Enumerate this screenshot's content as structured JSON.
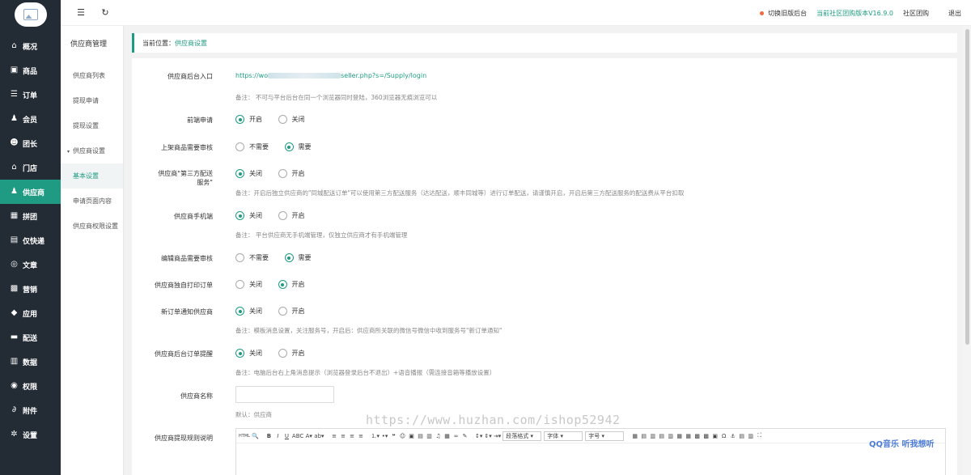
{
  "sidebar": {
    "items": [
      {
        "label": "概况",
        "icon": "home-icon",
        "glyph": "⌂"
      },
      {
        "label": "商品",
        "icon": "goods-icon",
        "glyph": "▣"
      },
      {
        "label": "订单",
        "icon": "order-icon",
        "glyph": "☰"
      },
      {
        "label": "会员",
        "icon": "member-icon",
        "glyph": "♟"
      },
      {
        "label": "团长",
        "icon": "leader-icon",
        "glyph": "☻"
      },
      {
        "label": "门店",
        "icon": "store-icon",
        "glyph": "⌂"
      },
      {
        "label": "供应商",
        "icon": "supplier-icon",
        "glyph": "♟"
      },
      {
        "label": "拼团",
        "icon": "group-buy-icon",
        "glyph": "▦"
      },
      {
        "label": "仅快递",
        "icon": "express-icon",
        "glyph": "▤"
      },
      {
        "label": "文章",
        "icon": "article-icon",
        "glyph": "◎"
      },
      {
        "label": "营销",
        "icon": "marketing-icon",
        "glyph": "▩"
      },
      {
        "label": "应用",
        "icon": "app-icon",
        "glyph": "◆"
      },
      {
        "label": "配送",
        "icon": "delivery-icon",
        "glyph": "▬"
      },
      {
        "label": "数据",
        "icon": "data-icon",
        "glyph": "▥"
      },
      {
        "label": "权限",
        "icon": "permission-icon",
        "glyph": "◉"
      },
      {
        "label": "附件",
        "icon": "attachment-icon",
        "glyph": "∂"
      },
      {
        "label": "设置",
        "icon": "settings-icon",
        "glyph": "✲"
      }
    ]
  },
  "subnav": {
    "title": "供应商管理",
    "items": [
      "供应商列表",
      "提现申请",
      "提现设置",
      "供应商设置",
      "基本设置",
      "申请页面内容",
      "供应商权限设置"
    ]
  },
  "topbar": {
    "collapse_icon": "☰",
    "refresh_icon": "↻",
    "switch_old": "切换旧版后台",
    "version": "当前社区团购版本V16.9.0",
    "community": "社区团购",
    "logout": "退出"
  },
  "breadcrumb": {
    "prefix": "当前位置：",
    "current": "供应商设置"
  },
  "form": {
    "entry": {
      "label": "供应商后台入口",
      "url_start": "https://wo",
      "url_end": "seller.php?s=/Supply/login",
      "note": "备注：  不可与平台后台在同一个浏览器同时登陆，360浏览器无痕浏览可以"
    },
    "frontend_apply": {
      "label": "前端申请",
      "opt1": "开启",
      "opt2": "关闭"
    },
    "goods_review": {
      "label": "上架商品需要审核",
      "opt1": "不需要",
      "opt2": "需要"
    },
    "third_party": {
      "label_line1": "供应商\"第三方配送",
      "label_line2": "服务\"",
      "opt1": "关闭",
      "opt2": "开启",
      "note": "备注：开启后独立供应商的\"同城配送订单\"可以使用第三方配送服务（达达配送，顺丰同城等）进行订单配送，请谨慎开启，开启后第三方配送服务的配送费从平台扣取"
    },
    "mobile": {
      "label": "供应商手机端",
      "opt1": "关闭",
      "opt2": "开启",
      "note": "备注：  平台供应商无手机端管理，仅独立供应商才有手机端管理"
    },
    "edit_review": {
      "label": "编辑商品需要审核",
      "opt1": "不需要",
      "opt2": "需要"
    },
    "print": {
      "label": "供应商独自打印订单",
      "opt1": "关闭",
      "opt2": "开启"
    },
    "notify": {
      "label": "新订单通知供应商",
      "opt1": "关闭",
      "opt2": "开启",
      "note": "备注：模板消息设置，关注服务号，开启后：供应商所关联的微信号微信中收到服务号\"新订单通知\""
    },
    "remind": {
      "label": "供应商后台订单提醒",
      "opt1": "关闭",
      "opt2": "开启",
      "note": "备注：电脑后台右上角消息提示（浏览器登录后台不退出）+语音播报（需连接音箱等播放设置）"
    },
    "name": {
      "label": "供应商名称",
      "value": "",
      "note": "默认：供应商"
    },
    "withdraw_rules": {
      "label": "供应商提现规则说明"
    }
  },
  "editor": {
    "html_btn": "HTML",
    "para_format": "段落格式",
    "font_family": "字体",
    "font_size": "字号"
  },
  "watermark": {
    "text": "https://www.huzhan.com/ishop52942",
    "qq": "QQ音乐 听我想听"
  },
  "colors": {
    "accent": "#1e9b82",
    "sidebar": "#232b34",
    "dot": "#f26b3a"
  }
}
